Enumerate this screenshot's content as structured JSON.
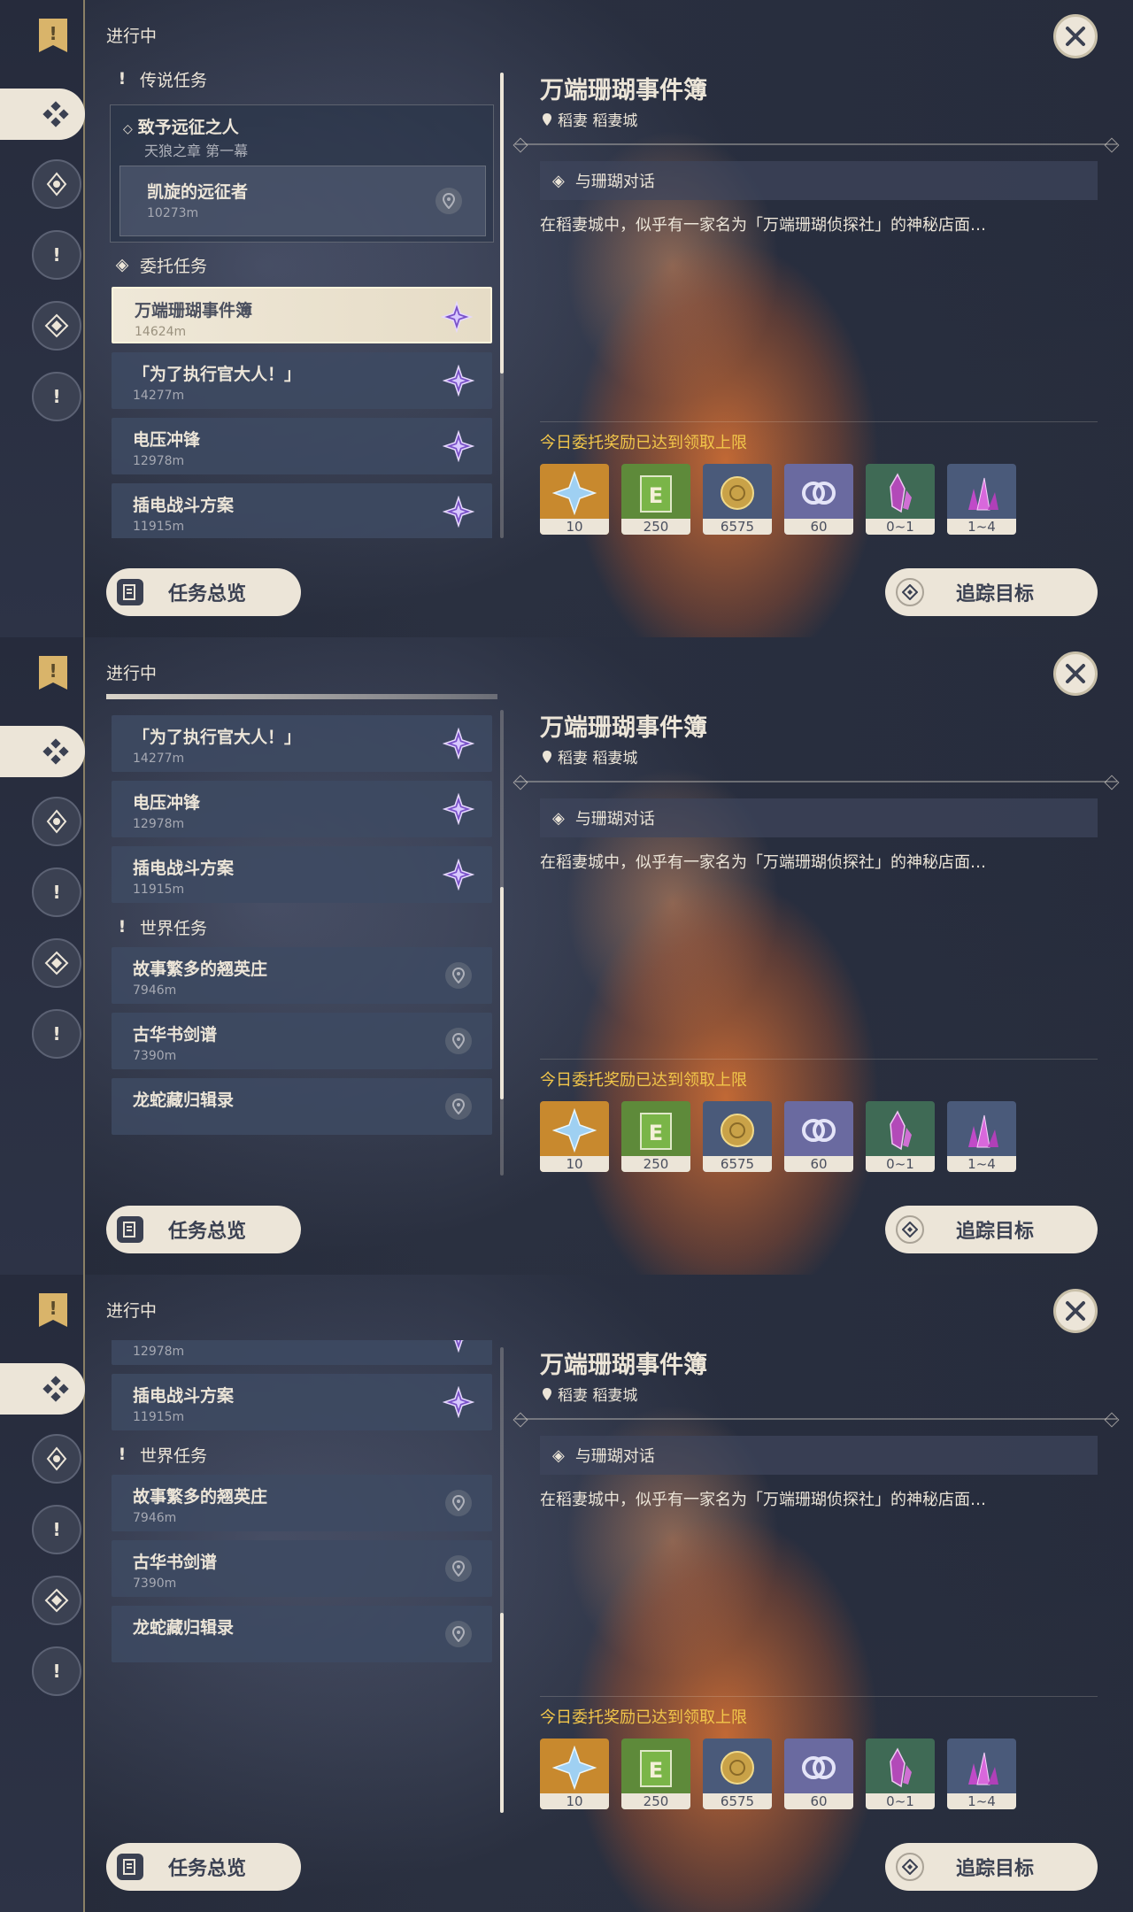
{
  "status_label": "进行中",
  "sections": {
    "legend": "传说任务",
    "commission": "委托任务",
    "world": "世界任务"
  },
  "legend_quest": {
    "title": "致予远征之人",
    "subtitle": "天狼之章 第一幕",
    "child_name": "凯旋的远征者",
    "child_dist": "10273m"
  },
  "commissions": [
    {
      "name": "万端珊瑚事件簿",
      "dist": "14624m"
    },
    {
      "name": "「为了执行官大人！」",
      "dist": "14277m"
    },
    {
      "name": "电压冲锋",
      "dist": "12978m"
    },
    {
      "name": "插电战斗方案",
      "dist": "11915m"
    }
  ],
  "world_quests": [
    {
      "name": "故事繁多的翘英庄",
      "dist": "7946m"
    },
    {
      "name": "古华书剑谱",
      "dist": "7390m"
    },
    {
      "name": "龙蛇藏归辑录",
      "dist": ""
    }
  ],
  "detail": {
    "title": "万端珊瑚事件簿",
    "location": "稻妻 稻妻城",
    "objective": "与珊瑚对话",
    "description": "在稻妻城中，似乎有一家名为「万端珊瑚侦探社」的神秘店面…",
    "limit_notice": "今日委托奖励已达到领取上限",
    "rewards": [
      {
        "icon": "primogem-icon",
        "count": "10",
        "color": "#c8892e"
      },
      {
        "icon": "exp-book-icon",
        "count": "250",
        "color": "#5e8a3a"
      },
      {
        "icon": "mora-icon",
        "count": "6575",
        "color": "#4a5a7a"
      },
      {
        "icon": "friendship-icon",
        "count": "60",
        "color": "#6a6aa0"
      },
      {
        "icon": "crystal-icon",
        "count": "0~1",
        "color": "#3f6a55"
      },
      {
        "icon": "crystal-cluster-icon",
        "count": "1~4",
        "color": "#4a5a7a"
      }
    ]
  },
  "buttons": {
    "overview": "任务总览",
    "track": "追踪目标"
  }
}
